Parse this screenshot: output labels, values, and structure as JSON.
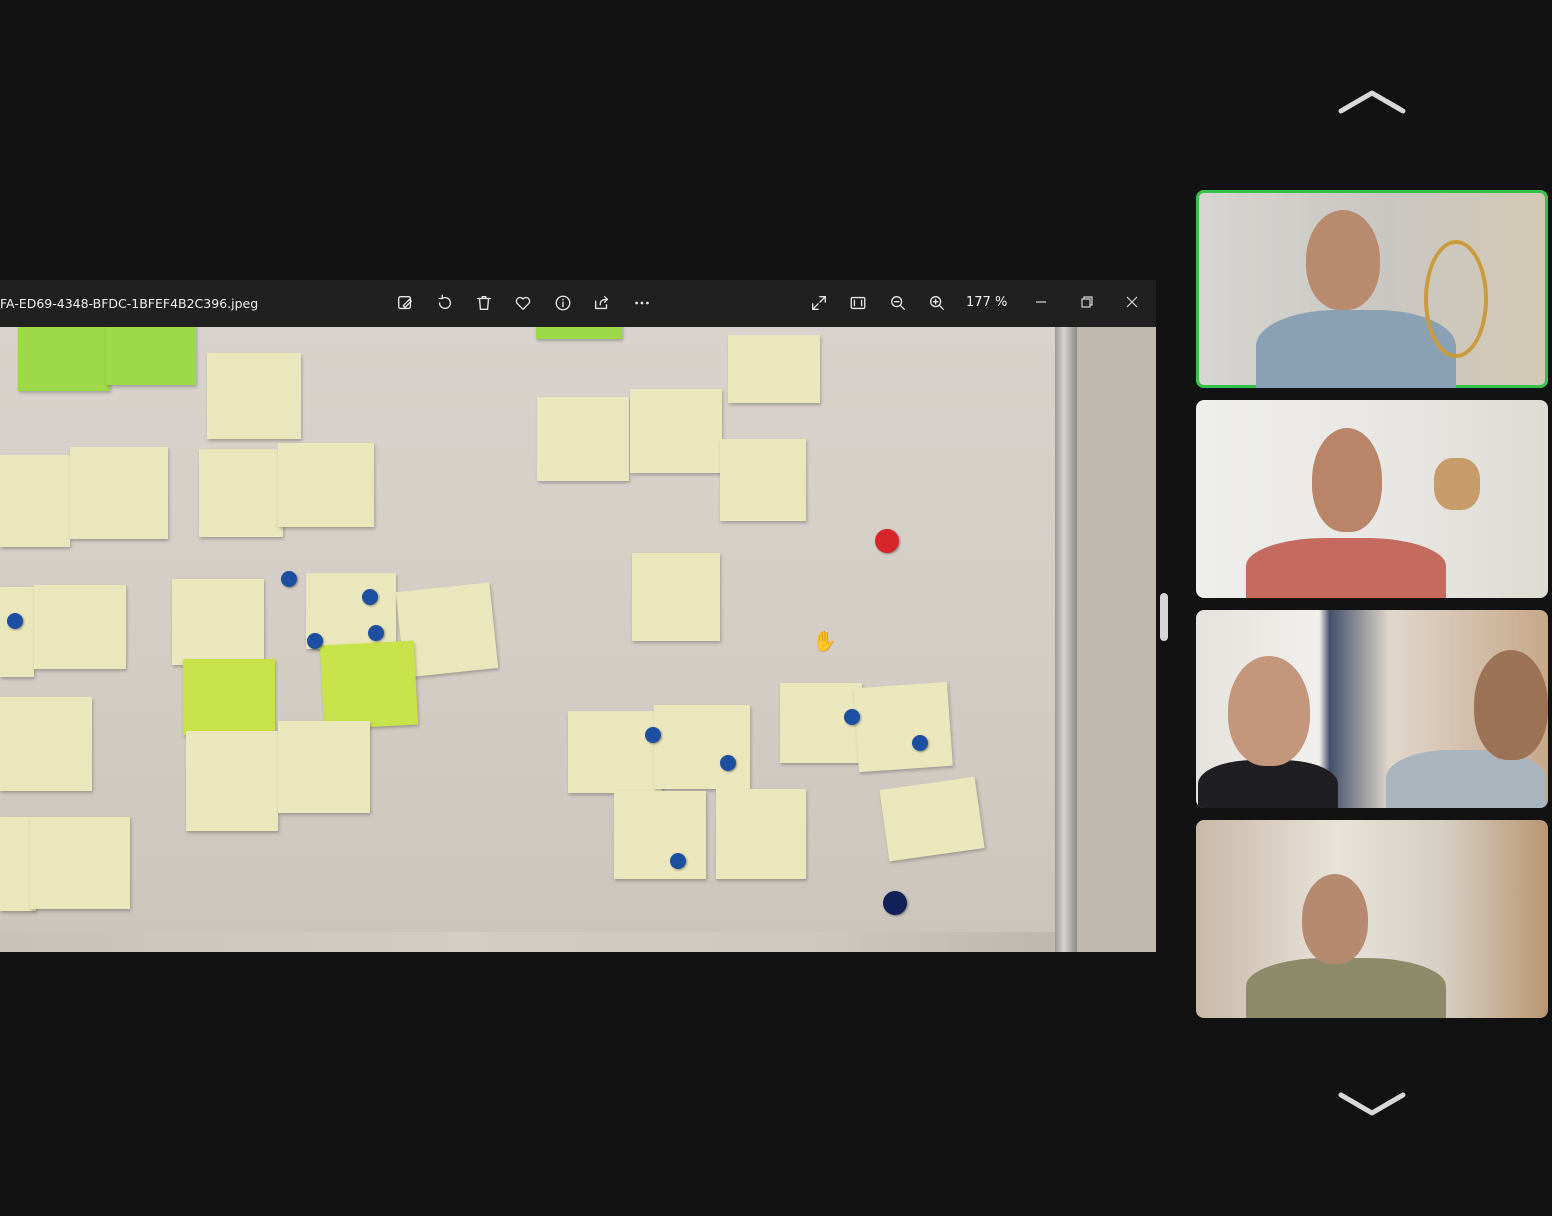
{
  "viewer": {
    "filename": "FA-ED69-4348-BFDC-1BFEF4B2C396.jpeg",
    "zoom": "177 %",
    "toolbar_icons": [
      "edit-icon",
      "rotate-icon",
      "delete-icon",
      "favorite-icon",
      "info-icon",
      "share-icon",
      "more-icon"
    ],
    "view_icons": [
      "expand-icon",
      "fit-icon",
      "zoom-out-icon",
      "zoom-in-icon"
    ],
    "window_icons": [
      "minimize-icon",
      "restore-icon",
      "close-icon"
    ]
  },
  "participants": {
    "count": 4,
    "active_index": 0,
    "active_color": "#35c24a",
    "nav_icons": [
      "chevron-up-icon",
      "chevron-down-icon"
    ]
  }
}
